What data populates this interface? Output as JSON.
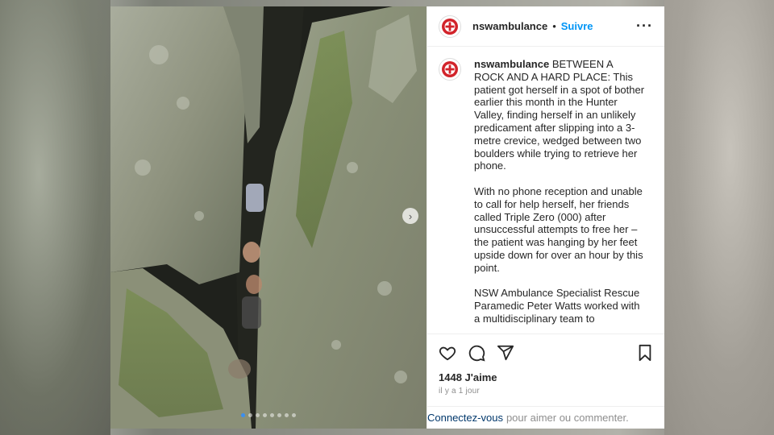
{
  "post": {
    "username": "nswambulance",
    "separator": "•",
    "follow_label": "Suivre",
    "more_icon": "more-horizontal-icon",
    "caption": {
      "username": "nswambulance",
      "paragraph1": "BETWEEN A ROCK AND A HARD PLACE: This patient got herself in a spot of bother earlier this month in the Hunter Valley, finding herself in an unlikely predicament after slipping into a 3-metre crevice, wedged between two boulders while trying to retrieve her phone.",
      "paragraph2": "With no phone reception and unable to call for help herself, her friends called Triple Zero (000) after unsuccessful attempts to free her – the patient was hanging by her feet upside down for over an hour by this point.",
      "paragraph3": "NSW Ambulance Specialist Rescue Paramedic Peter Watts worked with a multidisciplinary team to"
    },
    "likes": "1448 J'aime",
    "time_ago": "il y a 1 jour",
    "login_link": "Connectez-vous",
    "login_suffix": "pour aimer ou commenter.",
    "carousel": {
      "total": 8,
      "active": 0,
      "next_icon": "chevron-right-icon"
    },
    "icons": [
      "heart-icon",
      "comment-icon",
      "share-icon",
      "bookmark-icon"
    ],
    "colors": {
      "follow": "#0095f6",
      "link": "#00376b",
      "logo_red": "#d2232a",
      "logo_blue": "#1f3a8a"
    }
  }
}
